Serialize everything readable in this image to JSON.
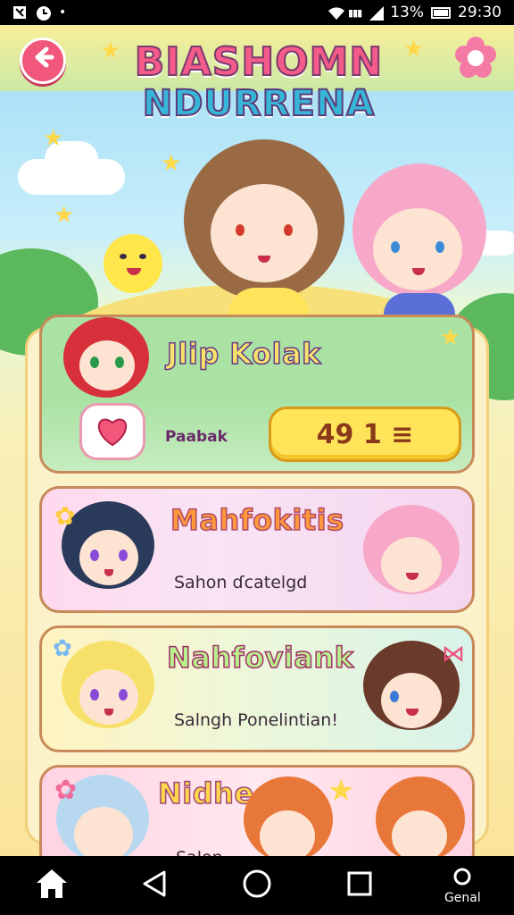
{
  "status_bar": {
    "battery": "13%",
    "time": "29:30"
  },
  "header": {
    "title_line1": "BIASHOMN",
    "title_line2": "NDURRENA"
  },
  "cards": [
    {
      "title": "Jlip Kolak",
      "tag_label": "Paabak",
      "price_button": "49 1 ≡"
    },
    {
      "title": "Mahfokitis",
      "subtitle": "Sahon ɗcatelgd"
    },
    {
      "title": "Nahfoviank",
      "subtitle": "Salngh Ponelintian!"
    },
    {
      "title": "Nidhees",
      "subtitle": "Salon"
    }
  ],
  "nav": {
    "home_icon": "home-icon",
    "back_icon": "triangle-back-icon",
    "circle_icon": "circle-home-icon",
    "recents_icon": "square-recents-icon",
    "extra_label": "Genal"
  },
  "colors": {
    "accent_pink": "#f45b8a",
    "accent_blue": "#38b6d8",
    "price_yellow": "#ffe45a"
  }
}
